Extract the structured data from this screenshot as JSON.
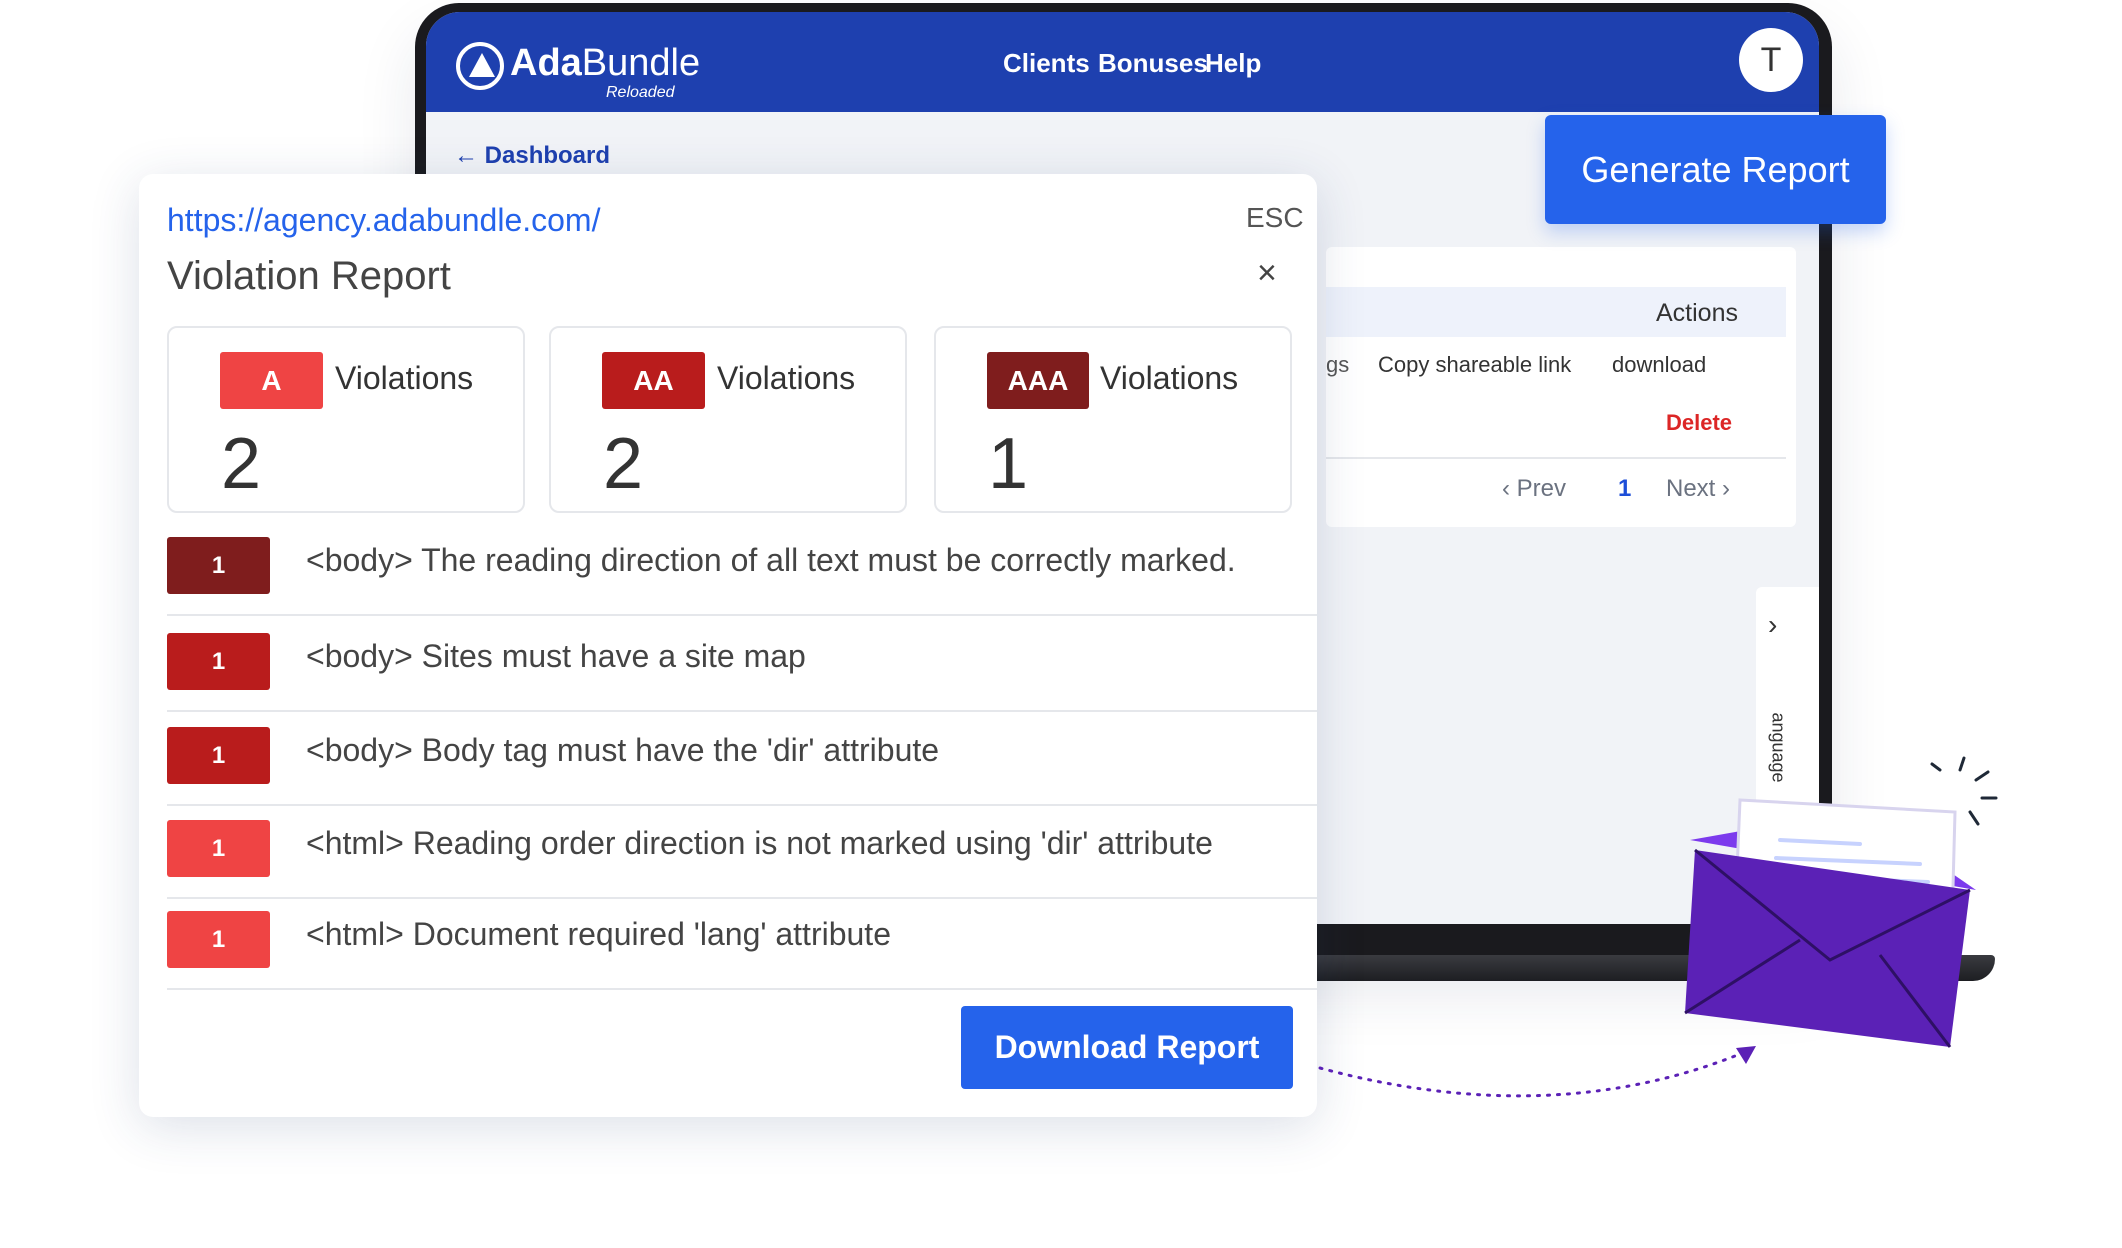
{
  "app": {
    "logo_bold": "Ada",
    "logo_regular": "Bundle",
    "logo_sub": "Reloaded",
    "nav": [
      "Clients",
      "Bonuses",
      "Help"
    ],
    "avatar_initial": "T",
    "back_link": "← Dashboard",
    "generate_button": "Generate Report",
    "table": {
      "actions_header": "Actions",
      "row_fragment": "gs",
      "copy_link": "Copy shareable link",
      "download": "download",
      "delete": "Delete",
      "pager_prev": "‹ Prev",
      "pager_page": "1",
      "pager_next": "Next ›"
    },
    "side_tab": {
      "chevron": "›",
      "label": "anguage"
    }
  },
  "modal": {
    "url": "https://agency.adabundle.com/",
    "esc": "ESC",
    "title": "Violation Report",
    "close": "×",
    "stats": [
      {
        "level": "A",
        "label": "Violations",
        "count": "2",
        "color": "#ef4444"
      },
      {
        "level": "AA",
        "label": "Violations",
        "count": "2",
        "color": "#b91c1c"
      },
      {
        "level": "AAA",
        "label": "Violations",
        "count": "1",
        "color": "#7f1d1d"
      }
    ],
    "violations": [
      {
        "count": "1",
        "text": "<body> The reading direction of all text must be correctly marked.",
        "color": "#7f1d1d"
      },
      {
        "count": "1",
        "text": "<body> Sites must have a site map",
        "color": "#b91c1c"
      },
      {
        "count": "1",
        "text": "<body> Body tag must have the 'dir' attribute",
        "color": "#b91c1c"
      },
      {
        "count": "1",
        "text": "<html> Reading order direction is not marked using 'dir' attribute",
        "color": "#ef4444"
      },
      {
        "count": "1",
        "text": "<html> Document required 'lang' attribute",
        "color": "#ef4444"
      }
    ],
    "download_button": "Download Report"
  },
  "colors": {
    "brand_blue": "#1e40af",
    "button_blue": "#2563eb",
    "envelope_purple": "#5b21b6"
  }
}
